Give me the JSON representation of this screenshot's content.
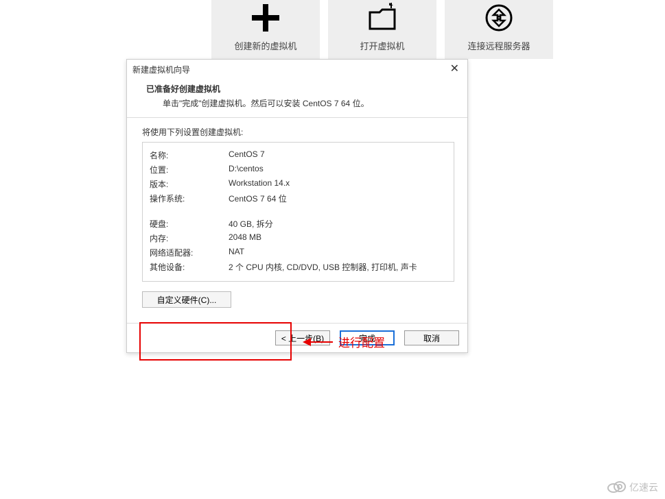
{
  "tiles": {
    "create": "创建新的虚拟机",
    "open": "打开虚拟机",
    "connect": "连接远程服务器"
  },
  "dialog": {
    "title": "新建虚拟机向导",
    "header_title": "已准备好创建虚拟机",
    "header_sub": "单击\"完成\"创建虚拟机。然后可以安装 CentOS 7 64 位。",
    "intro": "将使用下列设置创建虚拟机:",
    "settings": [
      {
        "label": "名称:",
        "value": "CentOS 7"
      },
      {
        "label": "位置:",
        "value": "D:\\centos"
      },
      {
        "label": "版本:",
        "value": "Workstation 14.x"
      },
      {
        "label": "操作系统:",
        "value": "CentOS 7 64 位"
      }
    ],
    "settings2": [
      {
        "label": "硬盘:",
        "value": "40 GB, 拆分"
      },
      {
        "label": "内存:",
        "value": "2048 MB"
      },
      {
        "label": "网络适配器:",
        "value": "NAT"
      },
      {
        "label": "其他设备:",
        "value": "2 个 CPU 内核, CD/DVD, USB 控制器, 打印机, 声卡"
      }
    ],
    "customize": "自定义硬件(C)...",
    "annotation": "进行配置",
    "back": "< 上一步(B)",
    "finish": "完成",
    "cancel": "取消"
  },
  "watermark": "亿速云"
}
